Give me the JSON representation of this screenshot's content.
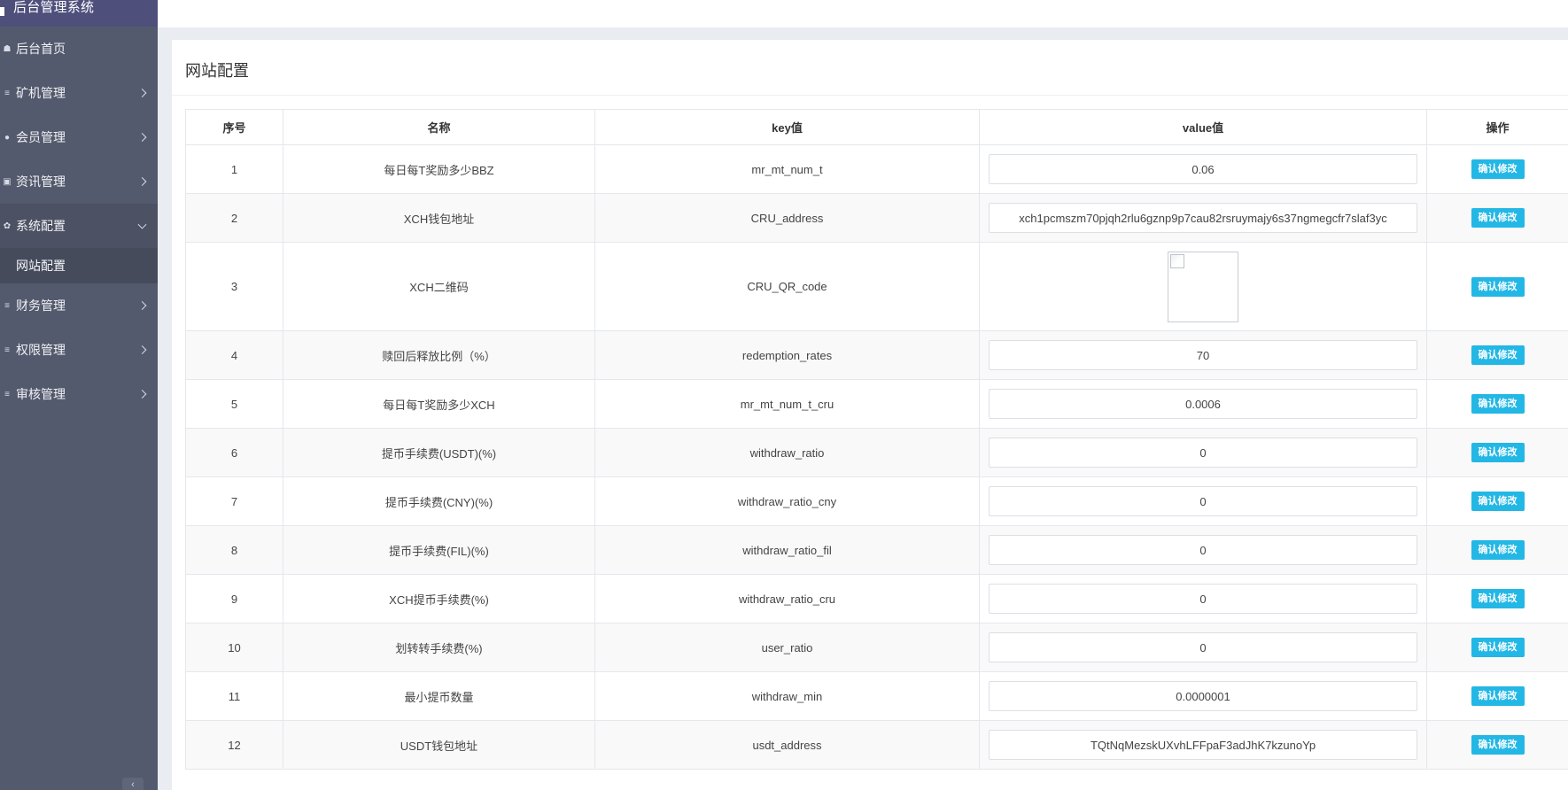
{
  "sidebar": {
    "brand": "后台管理系统",
    "items": [
      {
        "label": "后台首页",
        "icon": "home-icon",
        "has_arrow": false
      },
      {
        "label": "矿机管理",
        "icon": "list-icon",
        "has_arrow": true
      },
      {
        "label": "会员管理",
        "icon": "user-icon",
        "has_arrow": true
      },
      {
        "label": "资讯管理",
        "icon": "news-icon",
        "has_arrow": true
      },
      {
        "label": "系统配置",
        "icon": "cogs-icon",
        "has_arrow": true,
        "open": true
      },
      {
        "label": "财务管理",
        "icon": "list-icon",
        "has_arrow": true
      },
      {
        "label": "权限管理",
        "icon": "list-icon",
        "has_arrow": true
      },
      {
        "label": "审核管理",
        "icon": "list-icon",
        "has_arrow": true
      }
    ],
    "submenu": [
      "网站配置"
    ],
    "collapse_icon": "chevron-left-icon"
  },
  "panel": {
    "title": "网站配置"
  },
  "table": {
    "headers": [
      "序号",
      "名称",
      "key值",
      "value值",
      "操作"
    ],
    "action_label": "确认修改",
    "rows": [
      {
        "no": "1",
        "name": "每日每T奖励多少BBZ",
        "key": "mr_mt_num_t",
        "value": "0.06"
      },
      {
        "no": "2",
        "name": "XCH钱包地址",
        "key": "CRU_address",
        "value": "xch1pcmszm70pjqh2rlu6gznp9p7cau82rsruymajy6s37ngmegcfr7slaf3yc"
      },
      {
        "no": "3",
        "name": "XCH二维码",
        "key": "CRU_QR_code",
        "value": "",
        "image": true
      },
      {
        "no": "4",
        "name": "赎回后释放比例（%）",
        "key": "redemption_rates",
        "value": "70"
      },
      {
        "no": "5",
        "name": "每日每T奖励多少XCH",
        "key": "mr_mt_num_t_cru",
        "value": "0.0006"
      },
      {
        "no": "6",
        "name": "提币手续费(USDT)(%)",
        "key": "withdraw_ratio",
        "value": "0"
      },
      {
        "no": "7",
        "name": "提币手续费(CNY)(%)",
        "key": "withdraw_ratio_cny",
        "value": "0"
      },
      {
        "no": "8",
        "name": "提币手续费(FIL)(%)",
        "key": "withdraw_ratio_fil",
        "value": "0"
      },
      {
        "no": "9",
        "name": "XCH提币手续费(%)",
        "key": "withdraw_ratio_cru",
        "value": "0"
      },
      {
        "no": "10",
        "name": "划转转手续费(%)",
        "key": "user_ratio",
        "value": "0"
      },
      {
        "no": "11",
        "name": "最小提币数量",
        "key": "withdraw_min",
        "value": "0.0000001"
      },
      {
        "no": "12",
        "name": "USDT钱包地址",
        "key": "usdt_address",
        "value": "TQtNqMezskUXvhLFFpaF3adJhK7kzunoYp"
      }
    ]
  },
  "colors": {
    "sidebar_bg": "#545a6d",
    "brand_bg": "#4e4f7b",
    "accent_button": "#23b7e5",
    "page_bg": "#e9edf1"
  }
}
